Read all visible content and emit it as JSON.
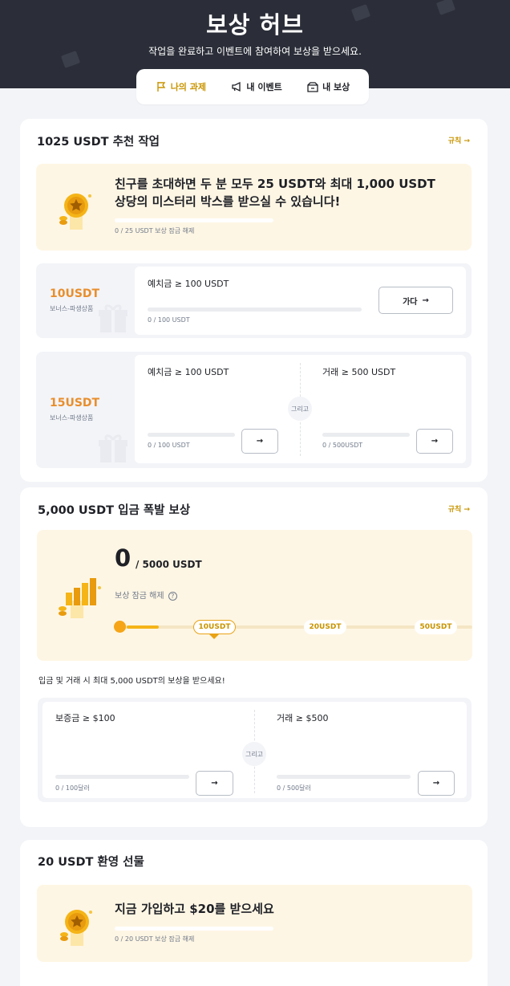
{
  "header": {
    "title": "보상 허브",
    "subtitle": "작업을 완료하고 이벤트에 참여하여 보상을 받으세요."
  },
  "tabs": [
    {
      "label": "나의 과제",
      "icon": "flag-icon",
      "active": true
    },
    {
      "label": "내 이벤트",
      "icon": "megaphone-icon",
      "active": false
    },
    {
      "label": "내 보상",
      "icon": "gift-box-icon",
      "active": false
    }
  ],
  "colors": {
    "accent": "#C99400",
    "amount": "#E88E2D",
    "banner": "#FEF6E4",
    "header": "#2B2E38"
  },
  "referral": {
    "title": "1025 USDT 추천 작업",
    "rules": "규칙",
    "banner_line1": "친구를 초대하면 두 분 모두 25 USDT와 최대 1,000 USDT",
    "banner_line2": "상당의 미스터리 박스를 받으실 수 있습니다!",
    "banner_progress_text": "0 / 25 USDT 보상 잠금 해제",
    "banner_progress": 0,
    "task1": {
      "amount": "10USDT",
      "kind": "보너스-파생상품",
      "condition": "예치금 ≥ 100 USDT",
      "progress_text": "0 / 100 USDT",
      "progress": 0,
      "button": "가다"
    },
    "task2": {
      "amount": "15USDT",
      "kind": "보너스-파생상품",
      "left_condition": "예치금 ≥ 100 USDT",
      "left_progress_text": "0 / 100 USDT",
      "right_condition": "거래 ≥ 500 USDT",
      "right_progress_text": "0 / 500USDT",
      "and": "그리고",
      "progress": 0
    }
  },
  "deposit": {
    "title": "5,000 USDT 입금 폭발 보상",
    "rules": "규칙",
    "current": "0",
    "target": "/ 5000 USDT",
    "unlock_label": "보상 잠금 해제",
    "milestones": [
      "10USDT",
      "20USDT",
      "50USDT"
    ],
    "note": "입금 및 거래 시 최대 5,000 USDT의 보상을 받으세요!",
    "left_condition": "보증금 ≥ $100",
    "left_progress_text": "0 / 100달러",
    "right_condition": "거래 ≥ $500",
    "right_progress_text": "0 / 500달러",
    "and": "그리고",
    "progress": 0
  },
  "welcome": {
    "title": "20 USDT 환영 선물",
    "banner_text": "지금 가입하고 $20를 받으세요",
    "progress_text": "0 / 20 USDT 보상 잠금 해제",
    "progress": 0
  }
}
